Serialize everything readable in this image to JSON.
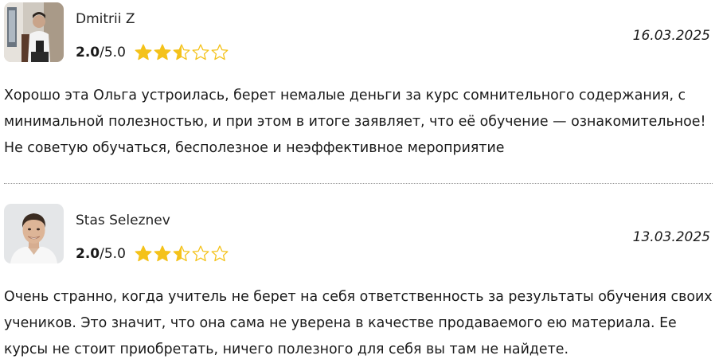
{
  "reviews": [
    {
      "author": "Dmitrii Z",
      "score": "2.0",
      "score_max": "/5.0",
      "rating_value": 2.5,
      "rating_max": 5,
      "date": "16.03.2025",
      "text": "Хорошо эта Ольга устроилась, берет немалые деньги за курс сомнительного содержания, с минимальной полезностью, и при этом в итоге заявляет, что её обучение — ознакомительное! Не советую обучаться, бесполезное и неэффективное мероприятие"
    },
    {
      "author": "Stas Seleznev",
      "score": "2.0",
      "score_max": "/5.0",
      "rating_value": 2.5,
      "rating_max": 5,
      "date": "13.03.2025",
      "text": "Очень странно, когда учитель не берет на себя ответственность за результаты обучения своих учеников. Это значит, что она сама не уверена в качестве продаваемого ею материала. Ее курсы не стоит приобретать, ничего полезного для себя вы там не найдете."
    }
  ],
  "colors": {
    "star": "#f4c21a",
    "text": "#1a1a1a",
    "divider": "#9a9a9a"
  },
  "icons": [
    "star-filled-icon",
    "star-half-icon",
    "star-empty-icon"
  ]
}
